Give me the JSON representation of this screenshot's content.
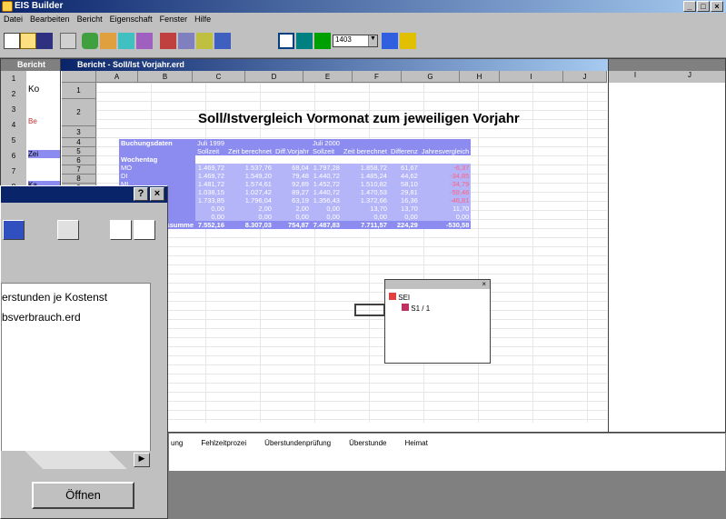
{
  "app": {
    "title": "EIS Builder",
    "controls": [
      "_",
      "□",
      "×"
    ]
  },
  "menu": [
    "Datei",
    "Bearbeiten",
    "Bericht",
    "Eigenschaft",
    "Fenster",
    "Hilfe"
  ],
  "toolbar": {
    "zoom_value": "1403"
  },
  "report_window": {
    "title": "Bericht - Soll/Ist Vorjahr.erd",
    "col_headers": [
      "A",
      "B",
      "C",
      "D",
      "E",
      "F",
      "G",
      "H",
      "I",
      "J"
    ]
  },
  "right_window": {
    "col_headers": [
      "I",
      "J"
    ]
  },
  "left_window": {
    "title": "Bericht",
    "row_labels": [
      "1",
      "2",
      "3",
      "4",
      "5",
      "6",
      "7",
      "8",
      "9"
    ],
    "cells": [
      "Ko",
      "Be",
      "Zei",
      "Ka",
      "Be"
    ]
  },
  "report": {
    "title": "Soll/Istvergleich Vormonat zum jeweiligen Vorjahr",
    "row_numbers": [
      "1",
      "2",
      "3",
      "4",
      "5",
      "6",
      "7",
      "8",
      "9"
    ],
    "header_label": "Buchungsdaten",
    "period1": "Juli 1999",
    "period2": "Juli 2000",
    "col_sub": [
      "Sollzeit",
      "Zeit berechnet",
      "Diff.Vorjahr",
      "Sollzeit",
      "Zeit berechnet",
      "Differenz",
      "Jahresvergleich"
    ],
    "weekday_label": "Wochentag",
    "rows": [
      {
        "day": "MO",
        "v": [
          "1.469,72",
          "1.537,76",
          "68,04",
          "1.797,28",
          "1.858,72",
          "61,67",
          "-6,37"
        ]
      },
      {
        "day": "DI",
        "v": [
          "1.469,72",
          "1.549,20",
          "79,48",
          "1.440,72",
          "1.485,24",
          "44,62",
          "-34,85"
        ]
      },
      {
        "day": "MI",
        "v": [
          "1.481,72",
          "1.574,61",
          "92,89",
          "1.452,72",
          "1.510,82",
          "58,10",
          "-34,79"
        ]
      },
      {
        "day": "",
        "v": [
          "1.038,15",
          "1.027,42",
          "89,27",
          "1.440,72",
          "1.470,53",
          "29,81",
          "-59,46"
        ]
      },
      {
        "day": "",
        "v": [
          "1.733,85",
          "1.796,04",
          "63,19",
          "1.356,43",
          "1.372,66",
          "16,36",
          "-46,81"
        ]
      },
      {
        "day": "",
        "v": [
          "0,00",
          "2,00",
          "2,00",
          "0,00",
          "13,70",
          "13,70",
          "11,70"
        ]
      },
      {
        "day": "",
        "v": [
          "0,00",
          "0,00",
          "0,00",
          "0,00",
          "0,00",
          "0,00",
          "0,00"
        ]
      }
    ],
    "sum_label": "ssumme",
    "sum": [
      "7.552,16",
      "8.307,03",
      "754,87",
      "7.487,83",
      "7.711,57",
      "224,29",
      "-530,58"
    ]
  },
  "small_window": {
    "items": [
      "SEI",
      "S1 / 1"
    ]
  },
  "dialog": {
    "help": "?",
    "close": "×",
    "list_items": [
      "erstunden je Kostenst",
      "bsverbrauch.erd"
    ],
    "open_label": "Öffnen"
  },
  "bottom_doc": {
    "labels": [
      "ung",
      "Fehlzeitprozei",
      "Überstundenprüfung",
      "Überstunde",
      "Heimat"
    ]
  }
}
